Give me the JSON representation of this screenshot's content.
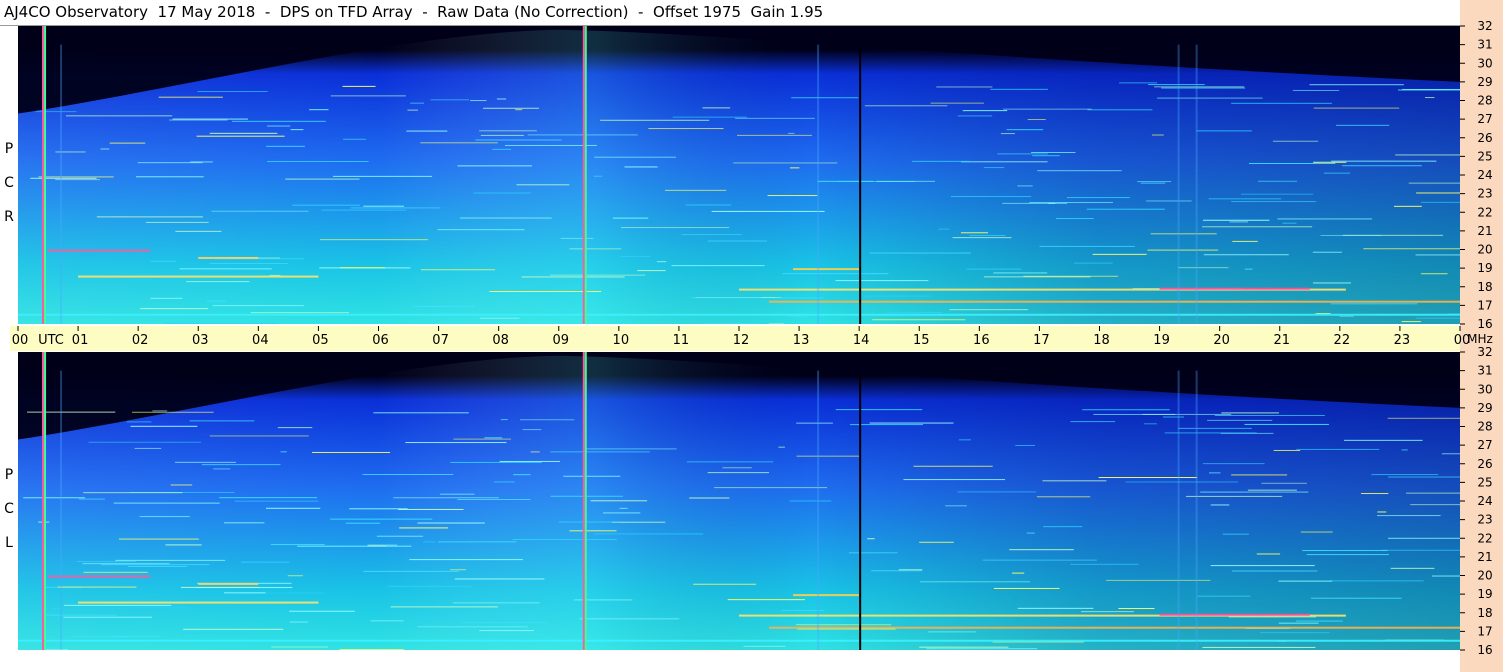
{
  "title": "AJ4CO Observatory  17 May 2018  -  DPS on TFD Array  -  Raw Data (No Correction)  -  Offset 1975  Gain 1.95",
  "panels": [
    {
      "id": "rcp",
      "label_letters": [
        "R",
        "C",
        "P"
      ]
    },
    {
      "id": "lcp",
      "label_letters": [
        "L",
        "C",
        "P"
      ]
    }
  ],
  "time_axis": {
    "labels": [
      "00",
      "01",
      "02",
      "03",
      "04",
      "05",
      "06",
      "07",
      "08",
      "09",
      "10",
      "11",
      "12",
      "13",
      "14",
      "15",
      "16",
      "17",
      "18",
      "19",
      "20",
      "21",
      "22",
      "23",
      "00"
    ],
    "unit_label": "UTC"
  },
  "freq_axis": {
    "labels": [
      "32",
      "31",
      "30",
      "29",
      "28",
      "27",
      "26",
      "25",
      "24",
      "23",
      "22",
      "21",
      "20",
      "19",
      "18",
      "17",
      "16"
    ],
    "unit_label": "MHz"
  },
  "colors": {
    "background": "#ffffff",
    "time_bar": "#fdfdc3",
    "right_strip": "#fbd9bf",
    "top_dark": "#000018",
    "spec_deep": "#0a2fd8",
    "spec_mid": "#1e6cf0",
    "spec_light": "#19c3e6",
    "spec_cyan": "#2fe3e3",
    "marker_pink": "#ff5aa0",
    "marker_green": "#3cff9a",
    "marker_black": "#000000"
  },
  "chart_data": {
    "type": "heatmap",
    "title": "AJ4CO Observatory  17 May 2018  -  DPS on TFD Array  -  Raw Data (No Correction)  -  Offset 1975  Gain 1.95",
    "xlabel": "UTC",
    "ylabel": "MHz",
    "xlim": [
      0,
      24
    ],
    "ylim": [
      16,
      32
    ],
    "x_unit": "hours UTC",
    "y_unit": "MHz",
    "panels": [
      "RCP",
      "LCP"
    ],
    "gridlines": false,
    "vertical_markers_utc": [
      0.4,
      9.4,
      14.0
    ],
    "notes": "Dynamic spectrum; intensity shown as color from black (low) through blue to cyan/yellow/red (high)."
  }
}
